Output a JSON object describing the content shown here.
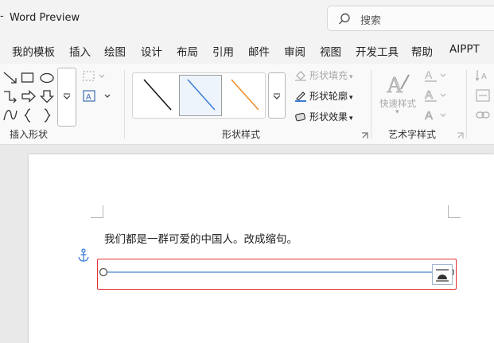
{
  "window": {
    "dash": "-",
    "title": "Word Preview"
  },
  "search": {
    "placeholder": "搜索"
  },
  "menu_tabs": [
    "我的模板",
    "插入",
    "绘图",
    "设计",
    "布局",
    "引用",
    "邮件",
    "审阅",
    "视图",
    "开发工具",
    "帮助",
    "AIPPT"
  ],
  "ribbon": {
    "insert_shapes": {
      "label": "插入形状"
    },
    "shape_styles": {
      "label": "形状样式",
      "fill": "形状填充",
      "outline": "形状轮廓",
      "effects": "形状效果"
    },
    "wordart": {
      "label": "艺术字样式",
      "quick_styles": "快速样式"
    }
  },
  "document": {
    "text": "我们都是一群可爱的中国人。改成缩句。"
  },
  "colors": {
    "selection_border": "#e03131",
    "line_stroke": "#4a86c8",
    "accent_orange": "#f08a24"
  }
}
